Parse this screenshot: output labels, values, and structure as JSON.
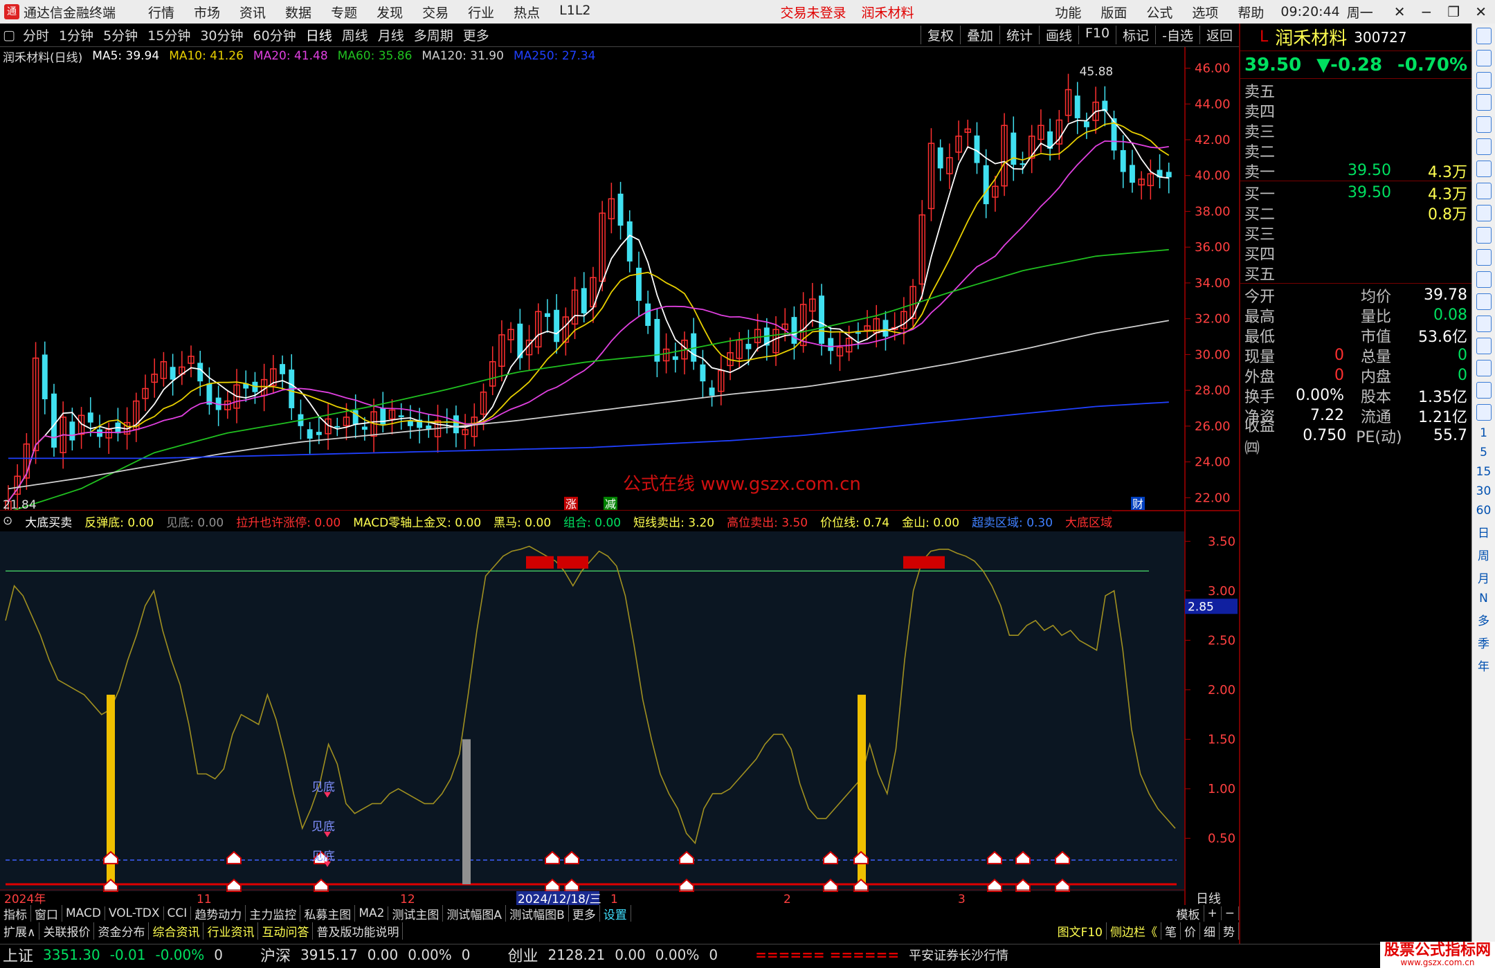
{
  "app": {
    "title": "通达信金融终端",
    "logo_text": "通",
    "menus": [
      "行情",
      "市场",
      "资讯",
      "数据",
      "专题",
      "发现",
      "交易",
      "行业",
      "热点",
      "L1L2"
    ],
    "trade_status": "交易未登录",
    "stock_tag": "润禾材料",
    "right_menus": [
      "功能",
      "版面",
      "公式",
      "选项",
      "帮助"
    ],
    "time": "09:20:44",
    "weekday": "周一"
  },
  "toolbar": {
    "periods": [
      "分时",
      "1分钟",
      "5分钟",
      "15分钟",
      "30分钟",
      "60分钟",
      "日线",
      "周线",
      "月线",
      "多周期",
      "更多"
    ],
    "active": "日线",
    "right_buttons": [
      "复权",
      "叠加",
      "统计",
      "画线",
      "F10",
      "标记",
      "-自选",
      "返回"
    ]
  },
  "ma_legend": {
    "title": "润禾材料(日线)",
    "items": [
      {
        "label": "MA5: 39.94",
        "color": "#ffffff"
      },
      {
        "label": "MA10: 41.26",
        "color": "#e8d000"
      },
      {
        "label": "MA20: 41.48",
        "color": "#e040e0"
      },
      {
        "label": "MA60: 35.86",
        "color": "#20c020"
      },
      {
        "label": "MA120: 31.90",
        "color": "#d0d0d0"
      },
      {
        "label": "MA250: 27.34",
        "color": "#2040ff"
      }
    ]
  },
  "chart_data": [
    {
      "type": "candlestick",
      "title": "润禾材料(日线)",
      "y_ticks": [
        "46.00",
        "44.00",
        "42.00",
        "40.00",
        "38.00",
        "36.00",
        "34.00",
        "32.00",
        "30.00",
        "28.00",
        "26.00",
        "24.00",
        "22.00"
      ],
      "ylim": [
        21.2,
        46.6
      ],
      "high_label": "45.88",
      "low_label": "21.84",
      "closes": [
        21.8,
        23.2,
        25.0,
        29.8,
        27.5,
        24.8,
        26.5,
        25.2,
        26.6,
        26.2,
        25.4,
        25.8,
        25.6,
        26.2,
        27.4,
        28.1,
        28.9,
        29.6,
        28.6,
        29.3,
        29.9,
        28.5,
        27.2,
        26.9,
        27.4,
        28.3,
        28.1,
        27.9,
        28.6,
        29.2,
        28.9,
        27.0,
        26.0,
        25.3,
        25.5,
        26.4,
        26.0,
        26.5,
        26.1,
        25.8,
        26.8,
        26.1,
        26.9,
        26.5,
        26.0,
        25.9,
        25.8,
        26.3,
        26.2,
        25.6,
        25.8,
        26.5,
        27.9,
        29.6,
        31.1,
        31.4,
        29.8,
        30.8,
        32.4,
        32.1,
        30.7,
        32.1,
        33.6,
        32.3,
        34.3,
        37.9,
        38.7,
        37.2,
        35.2,
        33.0,
        31.6,
        29.6,
        30.3,
        29.7,
        30.8,
        29.6,
        28.5,
        27.7,
        29.1,
        30.1,
        30.8,
        30.3,
        31.4,
        30.5,
        31.4,
        31.7,
        30.6,
        32.8,
        33.1,
        30.6,
        30.2,
        30.4,
        30.9,
        31.2,
        31.6,
        32.0,
        31.0,
        31.5,
        32.4,
        33.8,
        37.8,
        41.8,
        40.4,
        41.0,
        42.2,
        42.6,
        40.7,
        38.4,
        39.4,
        42.8,
        40.6,
        40.6,
        42.2,
        42.8,
        41.5,
        43.1,
        44.8,
        43.2,
        42.7,
        44.1,
        43.6,
        41.4,
        40.2,
        39.6,
        39.8,
        40.1,
        39.9,
        39.9
      ],
      "ma_series": [
        {
          "name": "MA5",
          "color": "#ffffff"
        },
        {
          "name": "MA10",
          "color": "#e8d000"
        },
        {
          "name": "MA20",
          "color": "#e040e0"
        },
        {
          "name": "MA60",
          "color": "#20c020",
          "values": [
            21.2,
            22.5,
            24.5,
            25.6,
            26.3,
            27.1,
            28.0,
            29.0,
            29.6,
            30.0,
            30.8,
            31.3,
            32.2,
            33.5,
            34.7,
            35.5,
            35.86
          ]
        },
        {
          "name": "MA120",
          "color": "#d0d0d0",
          "values": [
            22.5,
            23.1,
            23.8,
            24.5,
            25.1,
            25.5,
            25.9,
            26.3,
            26.8,
            27.3,
            27.8,
            28.2,
            28.8,
            29.5,
            30.3,
            31.2,
            31.9
          ]
        },
        {
          "name": "MA250",
          "color": "#2040ff",
          "values": [
            24.2,
            24.2,
            24.2,
            24.3,
            24.4,
            24.5,
            24.6,
            24.7,
            24.8,
            25.0,
            25.2,
            25.5,
            25.9,
            26.3,
            26.7,
            27.1,
            27.34
          ]
        }
      ]
    },
    {
      "type": "line",
      "title": "大底买卖",
      "y_ticks": [
        "3.50",
        "3.00",
        "2.50",
        "2.00",
        "1.50",
        "1.00",
        "0.50"
      ],
      "ylim": [
        0,
        3.6
      ],
      "current_label": "2.85",
      "level_line": 3.2,
      "dashed_level": 0.28,
      "values": [
        2.7,
        3.05,
        2.95,
        2.75,
        2.55,
        2.3,
        2.1,
        2.05,
        2.0,
        1.95,
        1.85,
        1.75,
        1.8,
        2.0,
        2.3,
        2.55,
        2.85,
        3.0,
        2.6,
        2.3,
        2.05,
        1.65,
        1.15,
        1.15,
        1.1,
        1.2,
        1.55,
        1.75,
        1.7,
        1.65,
        1.95,
        1.7,
        1.35,
        0.95,
        0.6,
        0.8,
        1.05,
        1.45,
        1.25,
        0.85,
        0.75,
        0.8,
        0.85,
        0.85,
        0.95,
        1.0,
        0.95,
        0.9,
        0.85,
        0.85,
        0.95,
        1.1,
        1.35,
        1.95,
        2.6,
        3.15,
        3.25,
        3.35,
        3.4,
        3.42,
        3.45,
        3.4,
        3.35,
        3.3,
        3.2,
        3.05,
        3.2,
        3.3,
        3.4,
        3.35,
        3.25,
        2.95,
        2.45,
        1.9,
        1.5,
        1.15,
        0.95,
        0.8,
        0.55,
        0.45,
        0.8,
        0.95,
        0.95,
        1.0,
        1.1,
        1.2,
        1.3,
        1.45,
        1.55,
        1.55,
        1.4,
        1.05,
        0.8,
        0.7,
        0.7,
        0.8,
        0.9,
        1.0,
        1.1,
        1.45,
        1.15,
        0.95,
        1.4,
        2.3,
        3.0,
        3.3,
        3.4,
        3.42,
        3.42,
        3.38,
        3.35,
        3.3,
        3.2,
        3.05,
        2.85,
        2.55,
        2.55,
        2.65,
        2.7,
        2.6,
        2.65,
        2.55,
        2.6,
        2.5,
        2.45,
        2.4,
        2.95,
        3.0,
        2.4,
        1.6,
        1.15,
        0.95,
        0.8,
        0.7,
        0.6
      ]
    }
  ],
  "indicator": {
    "name": "大底买卖",
    "items": [
      {
        "label": "反弹底: 0.00",
        "color": "#ffff50"
      },
      {
        "label": "见底: 0.00",
        "color": "#909090"
      },
      {
        "label": "拉升也许涨停: 0.00",
        "color": "#ff3030"
      },
      {
        "label": "MACD零轴上金叉: 0.00",
        "color": "#ffff50"
      },
      {
        "label": "黑马: 0.00",
        "color": "#ffff50"
      },
      {
        "label": "组合: 0.00",
        "color": "#00e060"
      },
      {
        "label": "短线卖出: 3.20",
        "color": "#ffff50"
      },
      {
        "label": "高位卖出: 3.50",
        "color": "#ff3030"
      },
      {
        "label": "价位线: 0.74",
        "color": "#ffff50"
      },
      {
        "label": "金山: 0.00",
        "color": "#ffff50"
      },
      {
        "label": "超卖区域: 0.30",
        "color": "#4080ff"
      },
      {
        "label": "大底区域",
        "color": "#ff3030"
      }
    ]
  },
  "markers": {
    "jiandi": "见底",
    "zhang": "涨",
    "jian": "减",
    "cai": "财"
  },
  "watermark": "公式在线  www.gszx.com.cn",
  "xaxis": {
    "labels": [
      "2024年",
      "11",
      "12",
      "2024/12/18/三",
      "1",
      "2",
      "3"
    ],
    "period": "日线"
  },
  "quote": {
    "name": "润禾材料",
    "code": "300727",
    "price": "39.50",
    "change": "▼-0.28",
    "pct": "-0.70%",
    "asks": [
      {
        "l": "卖五",
        "p": "",
        "v": ""
      },
      {
        "l": "卖四",
        "p": "",
        "v": ""
      },
      {
        "l": "卖三",
        "p": "",
        "v": ""
      },
      {
        "l": "卖二",
        "p": "",
        "v": ""
      },
      {
        "l": "卖一",
        "p": "39.50",
        "v": "4.3万"
      }
    ],
    "bids": [
      {
        "l": "买一",
        "p": "39.50",
        "v": "4.3万"
      },
      {
        "l": "买二",
        "p": "",
        "v": "0.8万"
      },
      {
        "l": "买三",
        "p": "",
        "v": ""
      },
      {
        "l": "买四",
        "p": "",
        "v": ""
      },
      {
        "l": "买五",
        "p": "",
        "v": ""
      }
    ],
    "stats": [
      [
        "今开",
        "",
        "均价",
        "39.78"
      ],
      [
        "最高",
        "",
        "量比",
        "0.08"
      ],
      [
        "最低",
        "",
        "市值",
        "53.6亿"
      ],
      [
        "现量",
        "0",
        "总量",
        "0"
      ],
      [
        "外盘",
        "0",
        "内盘",
        "0"
      ],
      [
        "换手",
        "0.00%",
        "股本",
        "1.35亿"
      ],
      [
        "净资",
        "7.22",
        "流通",
        "1.21亿"
      ],
      [
        "收益㈣",
        "0.750",
        "PE(动)",
        "55.7"
      ]
    ]
  },
  "tabs1": [
    "指标",
    "窗口",
    "MACD",
    "VOL-TDX",
    "CCI",
    "趋势动力",
    "主力监控",
    "私募主图",
    "MA2",
    "测试主图",
    "测试幅图A",
    "测试幅图B",
    "更多",
    "设置",
    "模板",
    "+",
    "−"
  ],
  "tabs2": [
    "扩展∧",
    "关联报价",
    "资金分布",
    "综合资讯",
    "行业资讯",
    "互动问答",
    "普及版功能说明",
    "图文F10",
    "侧边栏《",
    "笔",
    "价",
    "细",
    "势"
  ],
  "status": {
    "indices": [
      {
        "name": "上证",
        "val": "3351.30",
        "chg": "-0.01",
        "pct": "-0.00%",
        "vol": "0"
      },
      {
        "name": "沪深",
        "val": "3915.17",
        "chg": "0.00",
        "pct": "0.00%",
        "vol": "0"
      },
      {
        "name": "创业",
        "val": "2128.21",
        "chg": "0.00",
        "pct": "0.00%",
        "vol": "0"
      }
    ],
    "flow": "====== ======",
    "broker": "平安证券长沙行情",
    "site_logo": "股票公式指标网",
    "site_url": "www.gszx.com.cn"
  },
  "sidebar_labels": [
    "1",
    "5",
    "15",
    "30",
    "60",
    "日",
    "周",
    "月",
    "N",
    "多",
    "季",
    "年"
  ]
}
